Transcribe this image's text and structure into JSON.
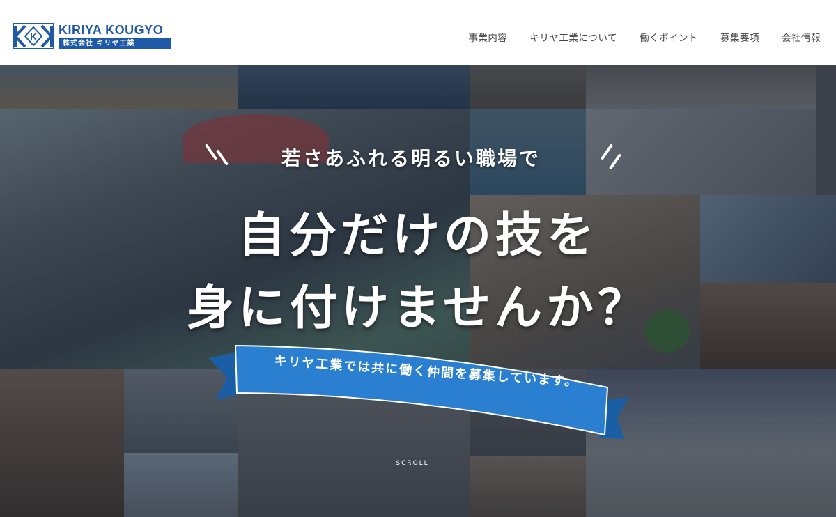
{
  "site": {
    "logo_en": "KIRIYA KOUGYO",
    "logo_ja": "株式会社 キリヤ工業",
    "logo_mark": "KK",
    "brand_color": "#1f5aa8"
  },
  "nav": {
    "items": [
      "事業内容",
      "キリヤ工業について",
      "働くポイント",
      "募集要項",
      "会社情報"
    ]
  },
  "hero": {
    "tagline": "若さあふれる明るい職場で",
    "headline_line1": "自分だけの技を",
    "headline_line2": "身に付けませんか？",
    "ribbon_text": "キリヤ工業では共に働く仲間を募集しています。",
    "ribbon_color": "#2a7fd1",
    "scroll_label": "SCROLL"
  }
}
